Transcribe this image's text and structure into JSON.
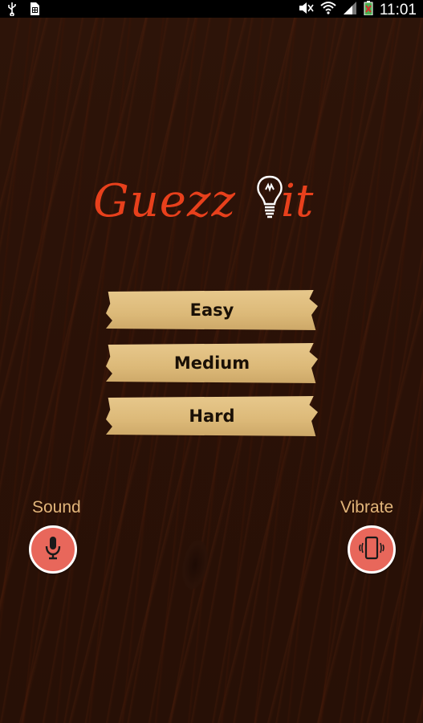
{
  "status_bar": {
    "time": "11:01",
    "left_icons": [
      "usb-icon",
      "sim-icon"
    ],
    "right_icons": [
      "mute-icon",
      "wifi-icon",
      "signal-icon",
      "battery-icon"
    ]
  },
  "logo": {
    "part1": "Guezz",
    "part2": "it",
    "icon": "lightbulb-icon",
    "color": "#e8401c"
  },
  "difficulty": {
    "easy": "Easy",
    "medium": "Medium",
    "hard": "Hard"
  },
  "settings": {
    "sound_label": "Sound",
    "vibrate_label": "Vibrate",
    "sound_icon": "microphone-icon",
    "vibrate_icon": "vibrate-phone-icon"
  },
  "colors": {
    "background": "#2a1208",
    "plank": "#dcb978",
    "accent": "#e8675b",
    "label": "#e2b57a"
  }
}
